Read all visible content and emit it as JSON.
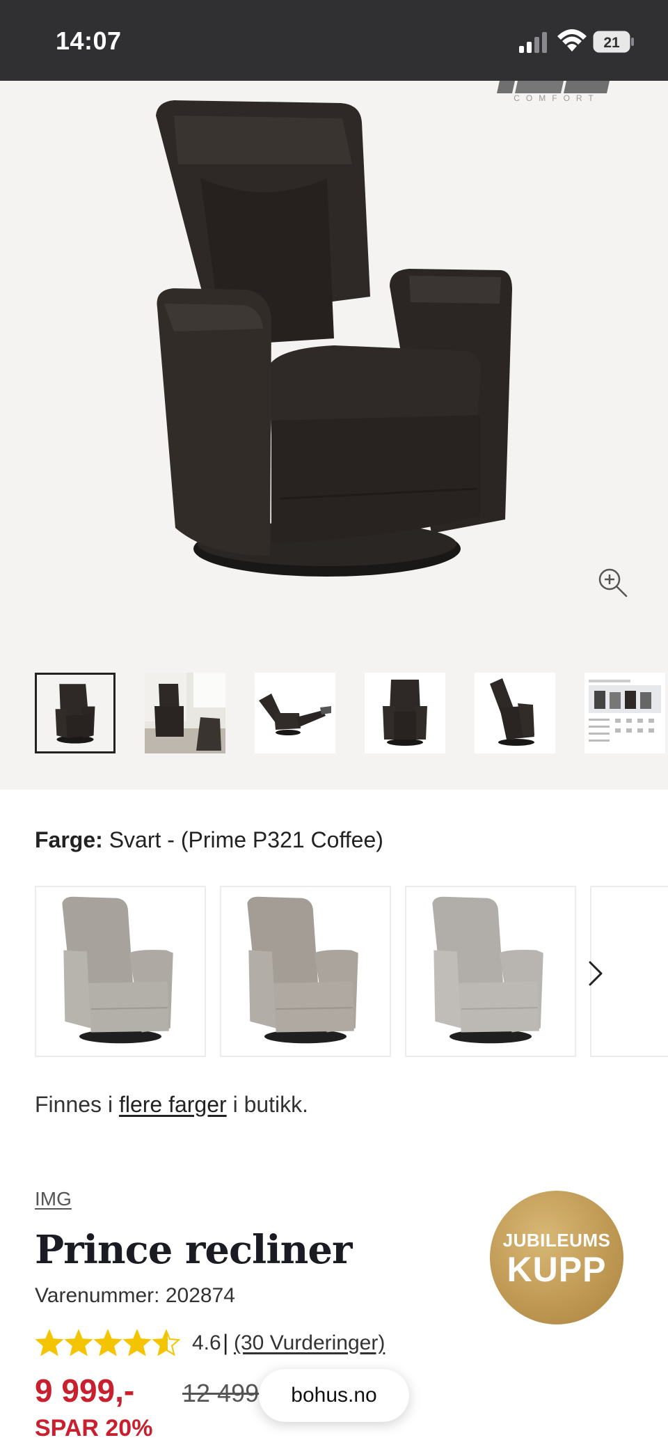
{
  "status_bar": {
    "time": "14:07",
    "battery": "21"
  },
  "gallery": {
    "brand_mark": "COMFORT",
    "thumbnail_count": 6,
    "active_thumbnail": 1
  },
  "color": {
    "label": "Farge:",
    "value": "Svart - (Prime P321 Coffee)"
  },
  "more_colors": {
    "prefix": "Finnes i",
    "link": "flere farger",
    "suffix": "i butikk."
  },
  "product": {
    "brand": "IMG",
    "title": "Prince recliner",
    "sku": "Varenummer: 202874",
    "rating": 4.6,
    "rating_text": "4.6",
    "rating_separator": "|",
    "reviews": "(30 Vurderinger)",
    "price": "9 999,-",
    "old_price": "12 499,-",
    "save": "SPAR 20%"
  },
  "badge": {
    "line1": "JUBILEUMS",
    "line2": "KUPP"
  },
  "site_pill": "bohus.no",
  "colors": {
    "status_bar_bg": "#303033",
    "price_red": "#c8202f",
    "badge_gold": "#c09a55",
    "gallery_bg": "#f4f3f1",
    "star_yellow": "#f5c400"
  }
}
